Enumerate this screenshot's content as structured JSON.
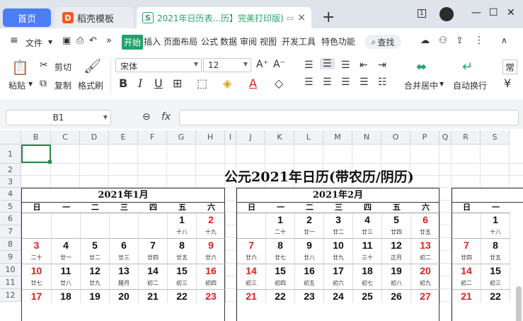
{
  "tabs": {
    "home": "首页",
    "daoke": "稻壳模板",
    "doc": "2021年日历表...历】完美打印版)",
    "close": "×",
    "plus": "+"
  },
  "window": {
    "badge": "1",
    "min": "—",
    "max": "☐",
    "close": "✕"
  },
  "toolbar": {
    "file": "文件",
    "more": "»",
    "menus": [
      "开始",
      "插入",
      "页面布局",
      "公式",
      "数据",
      "审阅",
      "视图",
      "开发工具",
      "特色功能"
    ],
    "search": "查找"
  },
  "ribbon": {
    "paste": "粘贴",
    "cut": "剪切",
    "copy": "复制",
    "format_painter": "格式刷",
    "font": "宋体",
    "size": "12",
    "bold": "B",
    "italic": "I",
    "underline": "U",
    "merge": "合并居中",
    "wrap": "自动换行",
    "normal": "常",
    "yuan": "¥"
  },
  "formula": {
    "cell": "B1",
    "fx": "fx",
    "value": ""
  },
  "sheet": {
    "columns": [
      "B",
      "C",
      "D",
      "E",
      "F",
      "G",
      "H",
      "I",
      "J",
      "K",
      "L",
      "M",
      "N",
      "O",
      "P",
      "Q",
      "R",
      "S"
    ],
    "rows": [
      "1",
      "2",
      "3",
      "4",
      "5",
      "6",
      "7",
      "8",
      "9",
      "10",
      "11",
      "12"
    ],
    "title": "公元2021年日历(带农历/阴历)",
    "weekdays": [
      "日",
      "一",
      "二",
      "三",
      "四",
      "五",
      "六"
    ]
  },
  "months": [
    {
      "title": "2021年1月",
      "days": [
        [
          "",
          "",
          "",
          "",
          "",
          "1",
          "2"
        ],
        [
          "",
          "",
          "",
          "",
          "",
          "十八",
          "十九"
        ],
        [
          "3",
          "4",
          "5",
          "6",
          "7",
          "8",
          "9"
        ],
        [
          "二十",
          "廿一",
          "廿二",
          "廿三",
          "廿四",
          "廿五",
          "廿六"
        ],
        [
          "10",
          "11",
          "12",
          "13",
          "14",
          "15",
          "16"
        ],
        [
          "廿七",
          "廿八",
          "廿九",
          "腊月",
          "初二",
          "初三",
          "初四"
        ],
        [
          "17",
          "18",
          "19",
          "20",
          "21",
          "22",
          "23"
        ]
      ]
    },
    {
      "title": "2021年2月",
      "days": [
        [
          "",
          "1",
          "2",
          "3",
          "4",
          "5",
          "6"
        ],
        [
          "",
          "二十",
          "廿一",
          "廿二",
          "廿三",
          "廿四",
          "廿五"
        ],
        [
          "7",
          "8",
          "9",
          "10",
          "11",
          "12",
          "13"
        ],
        [
          "廿六",
          "廿七",
          "廿八",
          "廿九",
          "三十",
          "正月",
          "初二"
        ],
        [
          "14",
          "15",
          "16",
          "17",
          "18",
          "19",
          "20"
        ],
        [
          "初三",
          "初四",
          "初五",
          "初六",
          "初七",
          "初八",
          "初九"
        ],
        [
          "21",
          "22",
          "23",
          "24",
          "25",
          "26",
          "27"
        ]
      ]
    },
    {
      "title": "",
      "days": [
        [
          "",
          "1"
        ],
        [
          "",
          "十八"
        ],
        [
          "7",
          "8"
        ],
        [
          "廿四",
          "廿五"
        ],
        [
          "14",
          "15"
        ],
        [
          "初二",
          "初三"
        ],
        [
          "21",
          "22"
        ]
      ]
    }
  ],
  "colors": {
    "accent": "#22a36b",
    "home_tab": "#4b7df5",
    "holiday_red": "#e41c1c"
  }
}
